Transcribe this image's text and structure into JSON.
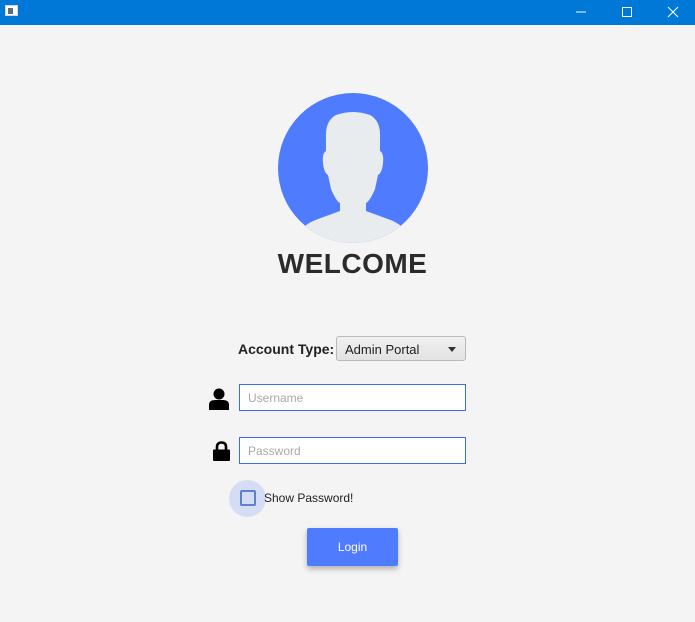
{
  "window": {
    "titlebar_color": "#0078d7",
    "controls": {
      "minimize": "minimize-icon",
      "maximize": "maximize-icon",
      "close": "close-icon"
    }
  },
  "header": {
    "avatar_icon": "user-avatar-icon",
    "avatar_color": "#4f7bff",
    "welcome_text": "WELCOME"
  },
  "form": {
    "account_type_label": "Account Type:",
    "account_type_value": "Admin Portal",
    "username_icon": "user-icon",
    "username_placeholder": "Username",
    "username_value": "",
    "password_icon": "lock-icon",
    "password_placeholder": "Password",
    "password_value": "",
    "show_password_label": "Show Password!",
    "show_password_checked": false,
    "login_label": "Login",
    "accent_color": "#4f7bff"
  }
}
